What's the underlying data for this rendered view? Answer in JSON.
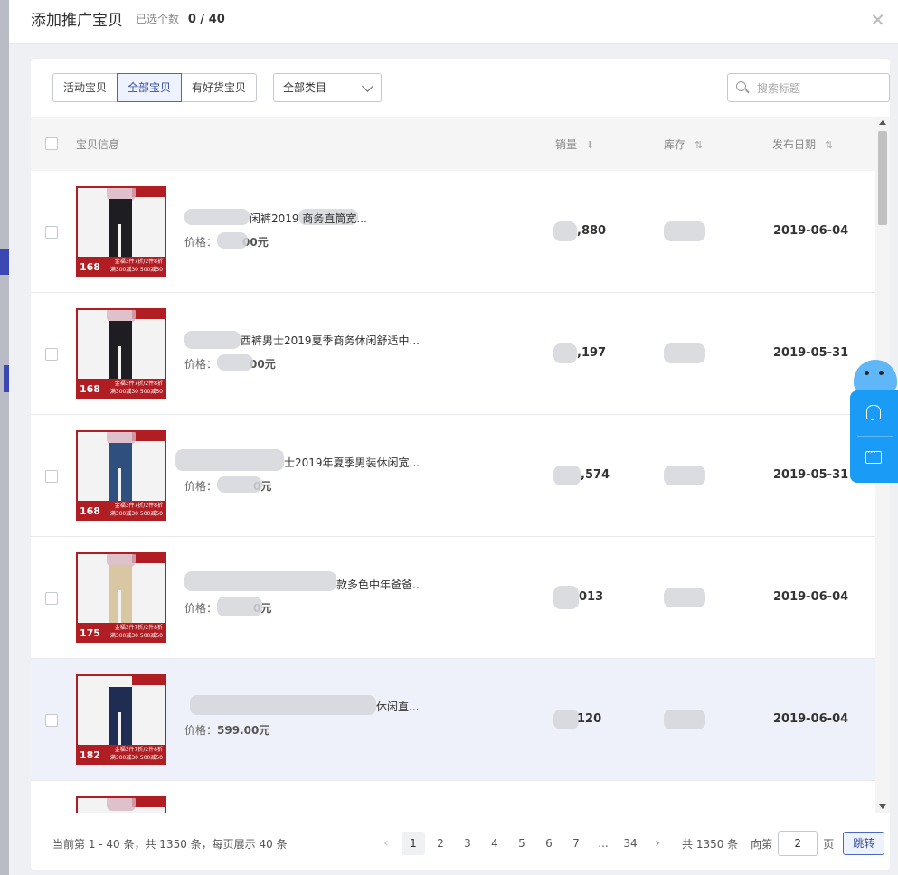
{
  "modal": {
    "title": "添加推广宝贝",
    "selected_label": "已选个数",
    "selected_value": "0 / 40",
    "close": "✕"
  },
  "filters": {
    "tabs": [
      {
        "label": "活动宝贝",
        "active": false
      },
      {
        "label": "全部宝贝",
        "active": true
      },
      {
        "label": "有好货宝贝",
        "active": false
      }
    ],
    "category": "全部类目",
    "search_placeholder": "搜索标题"
  },
  "table": {
    "columns": {
      "info": "宝贝信息",
      "sales": "销量",
      "stock": "库存",
      "date": "发布日期",
      "sales_sort": "⬇",
      "stock_sort": "⇅",
      "date_sort": "⇅"
    },
    "price_label": "价格：",
    "rows": [
      {
        "title": "闲裤2019 商务直筒宽...",
        "price": "00元",
        "sales": ",880",
        "date": "2019-06-04",
        "tag": "168"
      },
      {
        "title": "西裤男士2019夏季商务休闲舒适中...",
        "price": "00元",
        "sales": ",197",
        "date": "2019-05-31",
        "tag": "168"
      },
      {
        "title": "士2019年夏季男装休闲宽...",
        "price": "0元",
        "sales": ",574",
        "date": "2019-05-31",
        "tag": "168"
      },
      {
        "title": "款多色中年爸爸...",
        "price": "0元",
        "sales": "013",
        "date": "2019-06-04",
        "tag": "175"
      },
      {
        "title": "休闲直...",
        "price": "599.00元",
        "sales": "120",
        "date": "2019-06-04",
        "tag": "182"
      }
    ],
    "thumb_promo": "金福3件7折/2件8折",
    "thumb_promo2": "满300减30 500减50"
  },
  "pager": {
    "summary": "当前第 1 - 40 条，共 1350 条，每页展示 40 条",
    "pages": [
      "1",
      "2",
      "3",
      "4",
      "5",
      "6",
      "7",
      "...",
      "34"
    ],
    "prev": "‹",
    "next": "›",
    "total": "共 1350 条",
    "jump_prefix": "向第",
    "jump_value": "2",
    "jump_suffix": "页",
    "jump_button": "跳转"
  }
}
